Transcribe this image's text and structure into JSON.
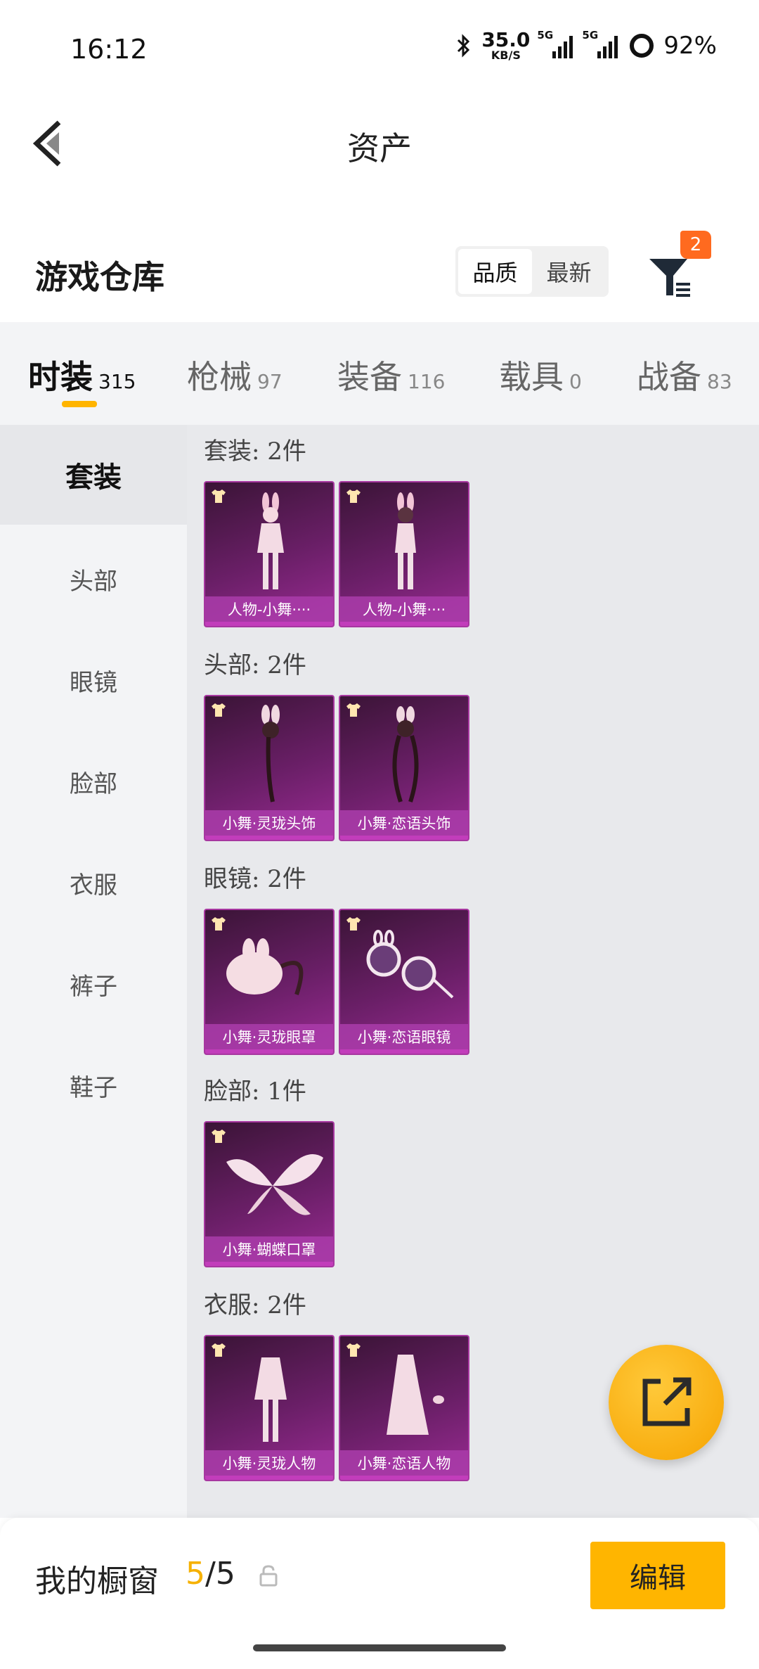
{
  "status": {
    "time": "16:12",
    "net_speed": "35.0",
    "net_unit": "KB/S",
    "signal1": "5G",
    "signal2": "5G",
    "battery": "92%"
  },
  "nav": {
    "title": "资产"
  },
  "header": {
    "title": "游戏仓库",
    "sort_options": [
      "品质",
      "最新"
    ],
    "filter_badge": "2"
  },
  "categories": [
    {
      "name": "时装",
      "count": "315"
    },
    {
      "name": "枪械",
      "count": "97"
    },
    {
      "name": "装备",
      "count": "116"
    },
    {
      "name": "载具",
      "count": "0"
    },
    {
      "name": "战备",
      "count": "83"
    }
  ],
  "sidebar": [
    "套装",
    "头部",
    "眼镜",
    "脸部",
    "衣服",
    "裤子",
    "鞋子"
  ],
  "sections": [
    {
      "title": "套装: 2件",
      "items": [
        "人物-小舞····",
        "人物-小舞····"
      ]
    },
    {
      "title": "头部: 2件",
      "items": [
        "小舞·灵珑头饰",
        "小舞·恋语头饰"
      ]
    },
    {
      "title": "眼镜: 2件",
      "items": [
        "小舞·灵珑眼罩",
        "小舞·恋语眼镜"
      ]
    },
    {
      "title": "脸部: 1件",
      "items": [
        "小舞·蝴蝶口罩"
      ]
    },
    {
      "title": "衣服: 2件",
      "items": [
        "小舞·灵珑人物",
        "小舞·恋语人物"
      ]
    }
  ],
  "showcase": {
    "label": "我的橱窗",
    "count_current": "5",
    "count_sep": "/5",
    "edit_label": "编辑"
  },
  "colors": {
    "accent": "#ffb500",
    "badge": "#ff6a1f",
    "card": "#6b1f68"
  }
}
